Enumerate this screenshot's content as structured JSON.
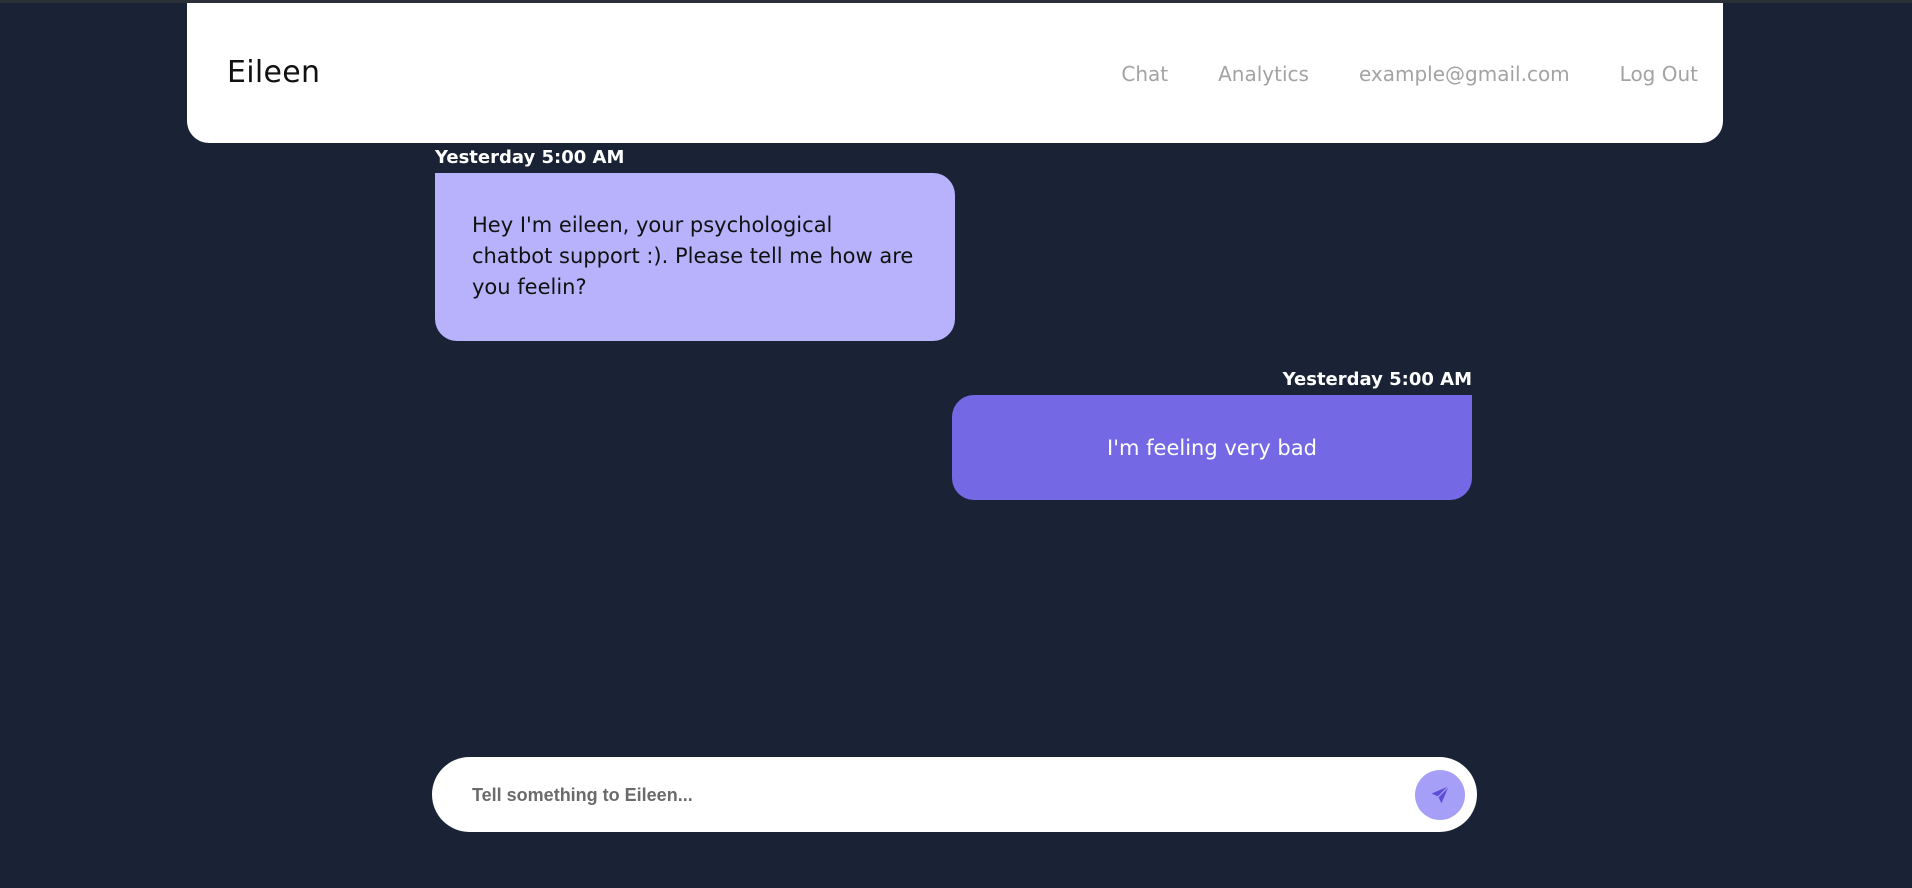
{
  "app": {
    "brand": "Eileen"
  },
  "nav": {
    "items": [
      {
        "label": "Chat"
      },
      {
        "label": "Analytics"
      },
      {
        "label": "example@gmail.com"
      },
      {
        "label": "Log Out"
      }
    ]
  },
  "messages": [
    {
      "sender": "bot",
      "timestamp": "Yesterday 5:00 AM",
      "text": "Hey I'm eileen, your psychological chatbot support :). Please tell me how are you feelin?"
    },
    {
      "sender": "user",
      "timestamp": "Yesterday 5:00 AM",
      "text": "I'm feeling very bad"
    }
  ],
  "composer": {
    "placeholder": "Tell something to Eileen...",
    "value": "",
    "send_icon": "send-icon"
  },
  "colors": {
    "background": "#1a2235",
    "bot_bubble": "#b7b2fb",
    "user_bubble": "#7468e4",
    "send_button": "#a69ff7"
  }
}
